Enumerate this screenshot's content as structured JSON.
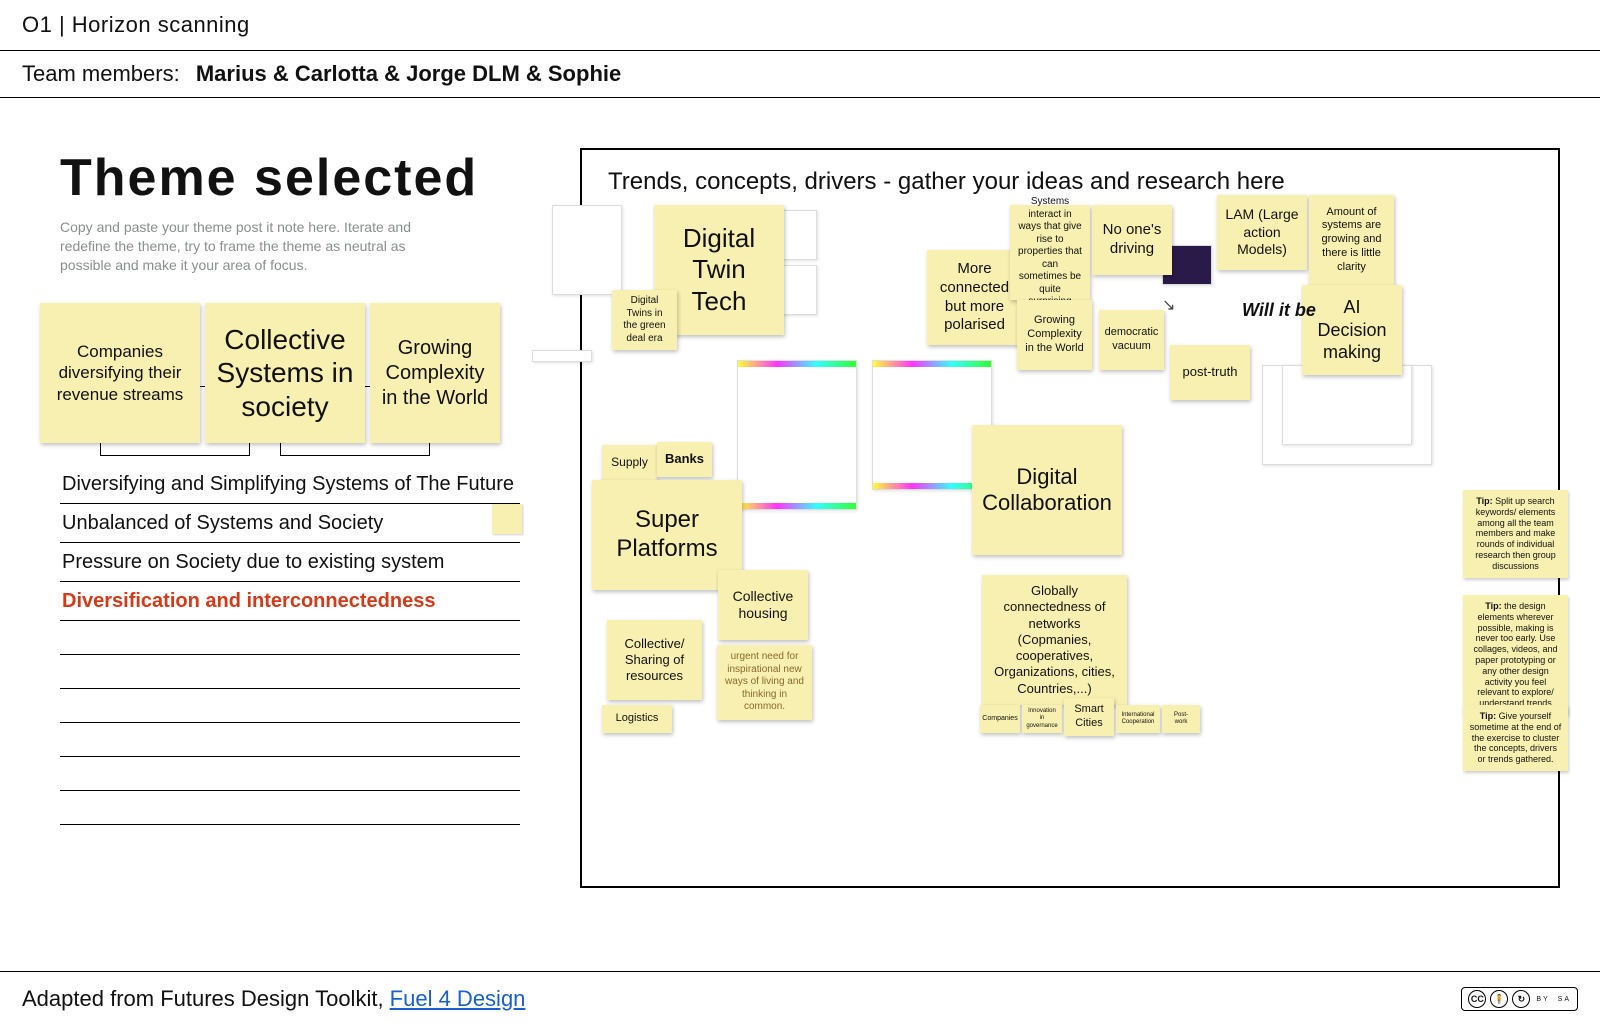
{
  "header": {
    "title": "O1 | Horizon scanning",
    "team_label": "Team members:",
    "team_value": "Marius & Carlotta & Jorge DLM & Sophie"
  },
  "left": {
    "title": "Theme selected",
    "desc": "Copy and paste your theme post it note here. Iterate and redefine the theme, try to frame the theme as neutral as possible and make it your area of focus.",
    "notes": [
      {
        "text": "Companies diversifying their revenue streams"
      },
      {
        "text": "Collective Systems in society"
      },
      {
        "text": "Growing Complexity in the World"
      }
    ],
    "slots": [
      "Diversifying and Simplifying Systems of The Future",
      "Unbalanced of Systems and Society",
      "Pressure on Society due to existing system",
      "Diversification and interconnectedness",
      "",
      "",
      "",
      "",
      "",
      ""
    ]
  },
  "board": {
    "title": "Trends, concepts, drivers - gather your ideas and research here",
    "cursive": "Will it be",
    "notes": {
      "digital_twin_tech": "Digital Twin Tech",
      "dt_green": "Digital Twins in the green deal era",
      "more_connected": "More connected but more polarised",
      "systems_interact": "Systems interact in ways that give rise to properties that can sometimes be quite surprising",
      "no_ones_driving": "No one's driving",
      "growing_complexity": "Growing Complexity in the World",
      "democratic_vacuum": "democratic vacuum",
      "lam": "LAM (Large action Models)",
      "amount_systems": "Amount of systems are growing and there is little clarity",
      "ai_decision": "AI Decision making",
      "post_truth": "post-truth",
      "supply": "Supply",
      "banks": "Banks",
      "super_platforms": "Super Platforms",
      "collective_housing": "Collective housing",
      "collective_sharing": "Collective/ Sharing of resources",
      "logistics": "Logistics",
      "urgent_need": "urgent need for inspirational new ways of living and thinking in common.",
      "digital_collab": "Digital Collaboration",
      "globally_connected": "Globally connectedness of networks (Copmanies, cooperatives, Organizations, cities, Countries,...)",
      "smart_cities": "Smart Cities",
      "companies": "Companies",
      "innovation": "Innovation in governance",
      "intl_coop": "International Cooperation",
      "post_work": "Post-work"
    },
    "tips": {
      "t1": "Split up search keywords/ elements among all the team members and make rounds of individual research then group discussions",
      "t2": "the design elements wherever possible, making is never too early. Use collages, videos, and paper prototyping or any other design activity you feel relevant to explore/ understand trends",
      "t3": "Give yourself sometime at the end of the exercise to cluster the concepts, drivers or trends gathered."
    }
  },
  "footer": {
    "text": "Adapted from Futures Design Toolkit, ",
    "link": "Fuel 4 Design",
    "cc": {
      "label": "CC",
      "by": "BY",
      "sa": "SA"
    }
  }
}
